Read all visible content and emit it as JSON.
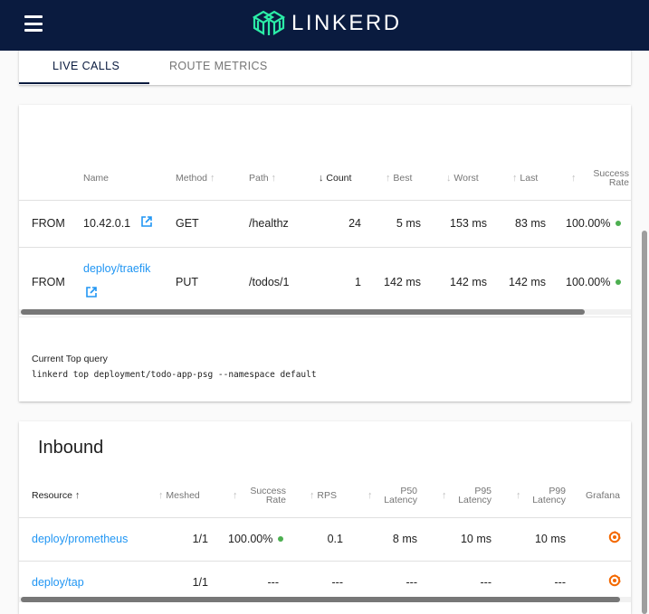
{
  "app": {
    "name": "LINKERD"
  },
  "tabs": [
    {
      "label": "LIVE CALLS",
      "active": true
    },
    {
      "label": "ROUTE METRICS",
      "active": false
    }
  ],
  "live_calls": {
    "headers": {
      "name": "Name",
      "method": "Method",
      "path": "Path",
      "count": "Count",
      "best": "Best",
      "worst": "Worst",
      "last": "Last",
      "success_1": "Success",
      "success_2": "Rate"
    },
    "rows": [
      {
        "direction": "FROM",
        "name": "10.42.0.1",
        "name_is_link": false,
        "method": "GET",
        "path": "/healthz",
        "count": "24",
        "best": "5 ms",
        "worst": "153 ms",
        "last": "83 ms",
        "success": "100.00%"
      },
      {
        "direction": "FROM",
        "name": "deploy/traefik",
        "name_is_link": true,
        "method": "PUT",
        "path": "/todos/1",
        "count": "1",
        "best": "142 ms",
        "worst": "142 ms",
        "last": "142 ms",
        "success": "100.00%"
      }
    ],
    "query_label": "Current Top query",
    "query": "linkerd top deployment/todo-app-psg --namespace default"
  },
  "inbound": {
    "title": "Inbound",
    "headers": {
      "resource": "Resource",
      "meshed": "Meshed",
      "success_1": "Success",
      "success_2": "Rate",
      "rps": "RPS",
      "p50_1": "P50",
      "p95_1": "P95",
      "p99_1": "P99",
      "latency": "Latency",
      "grafana": "Grafana"
    },
    "rows": [
      {
        "resource": "deploy/prometheus",
        "meshed": "1/1",
        "success": "100.00%",
        "rps": "0.1",
        "p50": "8 ms",
        "p95": "10 ms",
        "p99": "10 ms"
      },
      {
        "resource": "deploy/tap",
        "meshed": "1/1",
        "success": "---",
        "rps": "---",
        "p50": "---",
        "p95": "---",
        "p99": "---"
      }
    ]
  },
  "colors": {
    "navbar": "#0a1b3f",
    "link": "#2196f3",
    "success_dot": "#4caf50",
    "grafana": "#f46800",
    "logo_accent": "#2beda7"
  },
  "icons": {
    "menu": "hamburger-icon",
    "external": "external-link-icon",
    "grafana": "grafana-icon",
    "sort_up": "arrow-up-icon",
    "sort_down": "arrow-down-icon"
  }
}
